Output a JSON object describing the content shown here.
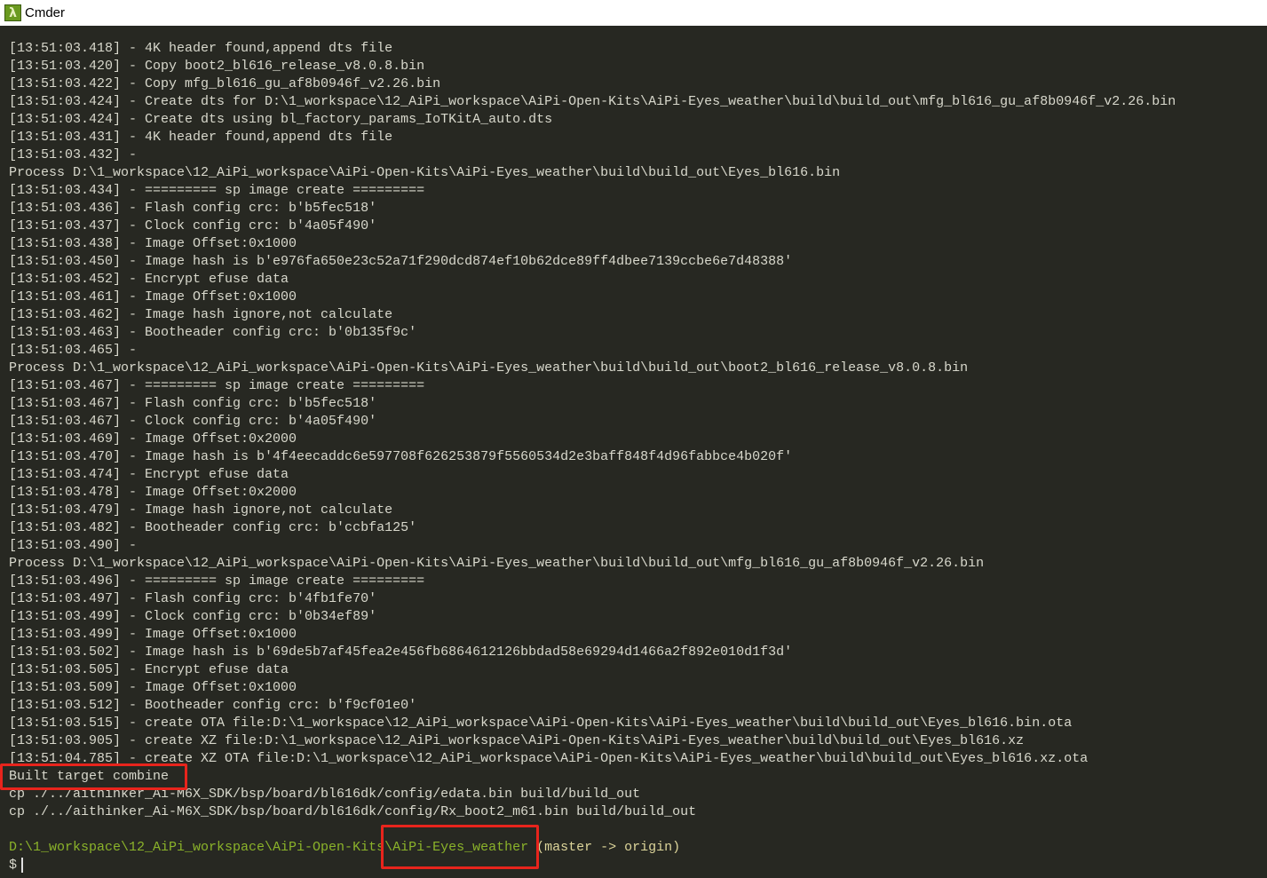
{
  "window": {
    "title": "Cmder",
    "icon": "lambda-icon"
  },
  "colors": {
    "background": "#272822",
    "text": "#d8d8cc",
    "path": "#8bb32a",
    "branch": "#ddd59a",
    "highlight": "#e8241c"
  },
  "log_lines": [
    "[13:51:03.418] - 4K header found,append dts file",
    "[13:51:03.420] - Copy boot2_bl616_release_v8.0.8.bin",
    "[13:51:03.422] - Copy mfg_bl616_gu_af8b0946f_v2.26.bin",
    "[13:51:03.424] - Create dts for D:\\1_workspace\\12_AiPi_workspace\\AiPi-Open-Kits\\AiPi-Eyes_weather\\build\\build_out\\mfg_bl616_gu_af8b0946f_v2.26.bin",
    "[13:51:03.424] - Create dts using bl_factory_params_IoTKitA_auto.dts",
    "[13:51:03.431] - 4K header found,append dts file",
    "[13:51:03.432] -",
    "Process D:\\1_workspace\\12_AiPi_workspace\\AiPi-Open-Kits\\AiPi-Eyes_weather\\build\\build_out\\Eyes_bl616.bin",
    "[13:51:03.434] - ========= sp image create =========",
    "[13:51:03.436] - Flash config crc: b'b5fec518'",
    "[13:51:03.437] - Clock config crc: b'4a05f490'",
    "[13:51:03.438] - Image Offset:0x1000",
    "[13:51:03.450] - Image hash is b'e976fa650e23c52a71f290dcd874ef10b62dce89ff4dbee7139ccbe6e7d48388'",
    "[13:51:03.452] - Encrypt efuse data",
    "[13:51:03.461] - Image Offset:0x1000",
    "[13:51:03.462] - Image hash ignore,not calculate",
    "[13:51:03.463] - Bootheader config crc: b'0b135f9c'",
    "[13:51:03.465] -",
    "Process D:\\1_workspace\\12_AiPi_workspace\\AiPi-Open-Kits\\AiPi-Eyes_weather\\build\\build_out\\boot2_bl616_release_v8.0.8.bin",
    "[13:51:03.467] - ========= sp image create =========",
    "[13:51:03.467] - Flash config crc: b'b5fec518'",
    "[13:51:03.467] - Clock config crc: b'4a05f490'",
    "[13:51:03.469] - Image Offset:0x2000",
    "[13:51:03.470] - Image hash is b'4f4eecaddc6e597708f626253879f5560534d2e3baff848f4d96fabbce4b020f'",
    "[13:51:03.474] - Encrypt efuse data",
    "[13:51:03.478] - Image Offset:0x2000",
    "[13:51:03.479] - Image hash ignore,not calculate",
    "[13:51:03.482] - Bootheader config crc: b'ccbfa125'",
    "[13:51:03.490] -",
    "Process D:\\1_workspace\\12_AiPi_workspace\\AiPi-Open-Kits\\AiPi-Eyes_weather\\build\\build_out\\mfg_bl616_gu_af8b0946f_v2.26.bin",
    "[13:51:03.496] - ========= sp image create =========",
    "[13:51:03.497] - Flash config crc: b'4fb1fe70'",
    "[13:51:03.499] - Clock config crc: b'0b34ef89'",
    "[13:51:03.499] - Image Offset:0x1000",
    "[13:51:03.502] - Image hash is b'69de5b7af45fea2e456fb6864612126bbdad58e69294d1466a2f892e010d1f3d'",
    "[13:51:03.505] - Encrypt efuse data",
    "[13:51:03.509] - Image Offset:0x1000",
    "[13:51:03.512] - Bootheader config crc: b'f9cf01e0'",
    "[13:51:03.515] - create OTA file:D:\\1_workspace\\12_AiPi_workspace\\AiPi-Open-Kits\\AiPi-Eyes_weather\\build\\build_out\\Eyes_bl616.bin.ota",
    "[13:51:03.905] - create XZ file:D:\\1_workspace\\12_AiPi_workspace\\AiPi-Open-Kits\\AiPi-Eyes_weather\\build\\build_out\\Eyes_bl616.xz",
    "[13:51:04.785] - create XZ OTA file:D:\\1_workspace\\12_AiPi_workspace\\AiPi-Open-Kits\\AiPi-Eyes_weather\\build\\build_out\\Eyes_bl616.xz.ota",
    "Built target combine",
    "cp ./../aithinker_Ai-M6X_SDK/bsp/board/bl616dk/config/edata.bin build/build_out",
    "cp ./../aithinker_Ai-M6X_SDK/bsp/board/bl616dk/config/Rx_boot2_m61.bin build/build_out",
    ""
  ],
  "prompt": {
    "path_prefix": "D:\\1_workspace\\12_AiPi_workspace\\AiPi-Open-Kits",
    "path_last": "\\AiPi-Eyes_weather",
    "branch": " (master -> origin)",
    "symbol": "$"
  }
}
